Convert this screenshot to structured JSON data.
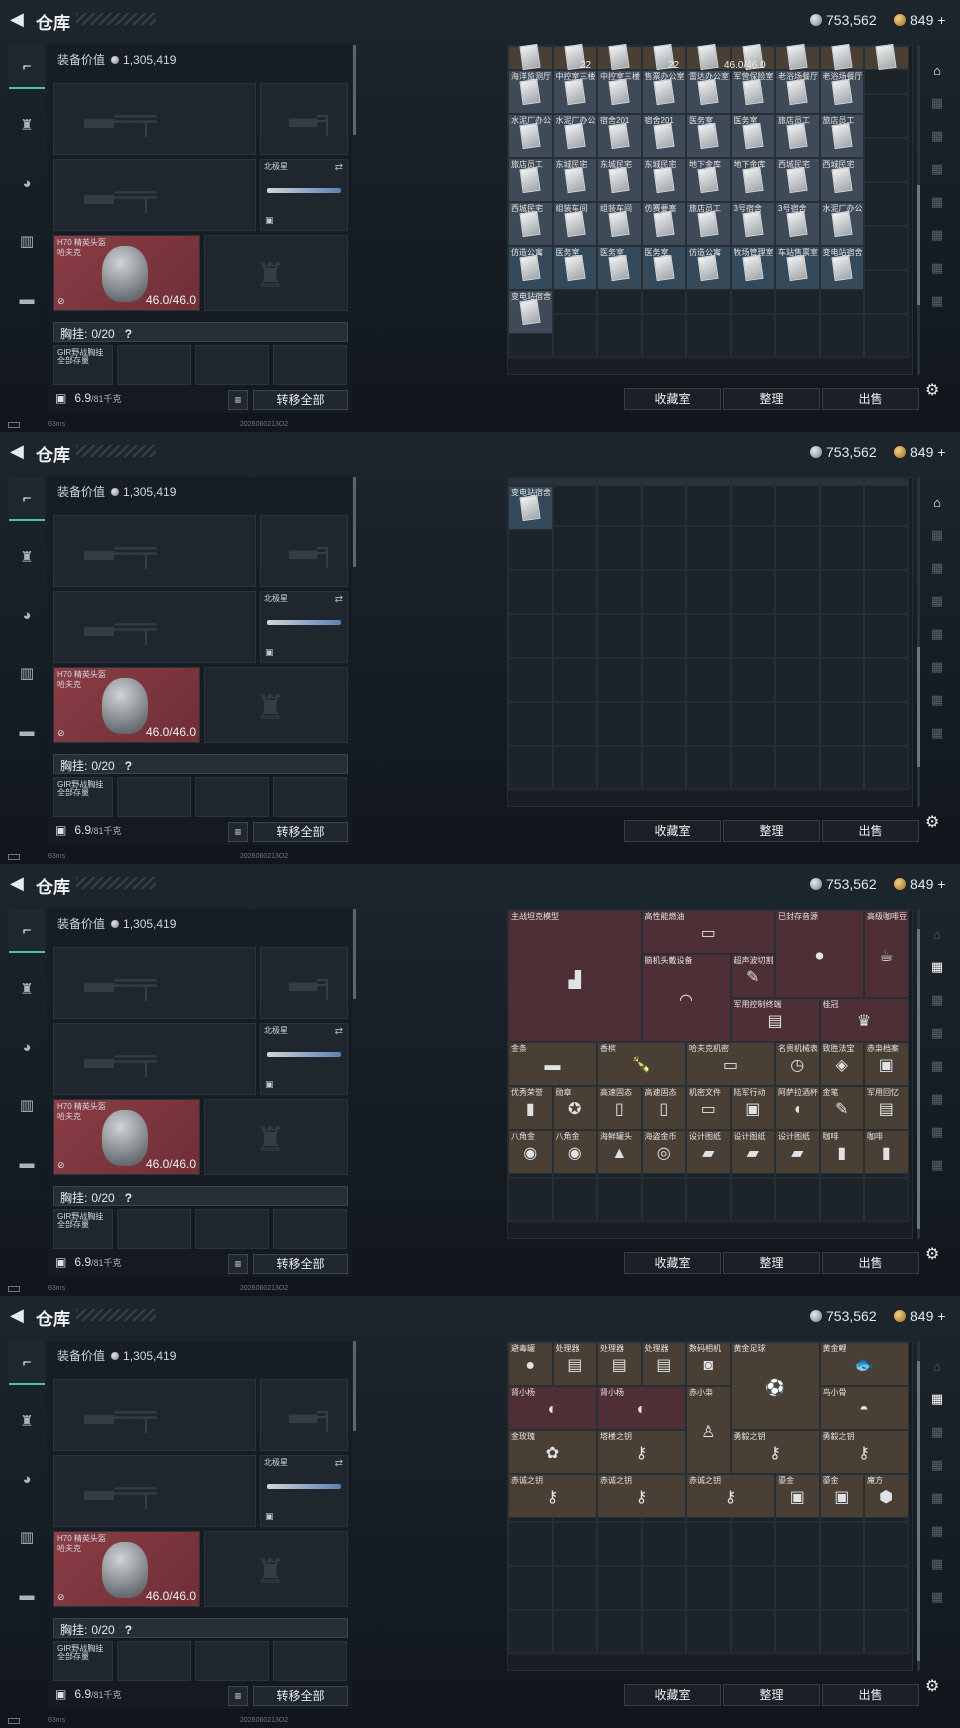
{
  "header": {
    "title": "仓库",
    "silver": "753,562",
    "gold": "849",
    "plus": "+"
  },
  "loadout": {
    "value_label": "装备价值",
    "value": "1,305,419",
    "melee_label": "北极星",
    "helmet_name": "H70 精英头盔",
    "helmet_sub": "哈夫克",
    "durability": "46.0/46.0",
    "chest_label": "胸挂:",
    "chest_value": "0/20",
    "chest_help": "?",
    "bag_label": "GIR野战胸挂",
    "bag_sub": "全部存量",
    "weight": "6.9",
    "weight_unit": "/81千克",
    "transfer_all": "转移全部"
  },
  "actions": {
    "collection": "收藏室",
    "organize": "整理",
    "sell": "出售"
  },
  "status": {
    "ping": "63ms",
    "build": "2026060213O2"
  },
  "panel1": {
    "top_partial": [
      "",
      "",
      "",
      "",
      ""
    ],
    "top_values": [
      "22",
      "22",
      "46.0/46.0"
    ],
    "rows": [
      [
        "海洋监测厅",
        "中控室三楼",
        "中控室三楼",
        "售票办公室",
        "雷达办公室",
        "军营保险室",
        "老浴场餐厅",
        "老浴场餐厅"
      ],
      [
        "水泥厂办公",
        "水泥厂办公",
        "宿舍201",
        "宿舍201",
        "医务室",
        "医务室",
        "旅店员工",
        "旅店员工"
      ],
      [
        "旅店员工",
        "东城民宅",
        "东城民宅",
        "东城民宅",
        "地下金库",
        "地下金库",
        "西城民宅",
        "西城民宅"
      ],
      [
        "西城民宅",
        "组装车间",
        "组装车间",
        "仿赛要塞",
        "旅店员工",
        "3号宿舍",
        "3号宿舍",
        "水泥厂办公"
      ],
      [
        "仿造公寓",
        "医务室",
        "医务室",
        "医务室",
        "仿造公寓",
        "牧场管理室",
        "车站售票室",
        "变电站宿舍"
      ],
      [
        "变电站宿舍"
      ]
    ]
  },
  "panel2": {
    "item": "变电站宿舍"
  },
  "panel3": {
    "items": [
      "主战坦克模型",
      "高性能燃油",
      "已封存音源",
      "高级咖啡豆",
      "脑机头戴设备",
      "超声波切割",
      "军用控制终端",
      "桂冠",
      "金条",
      "香槟",
      "哈夫克机密",
      "名贵机械表",
      "致胜法宝",
      "赤枭档案",
      "优秀荣誉",
      "勋章",
      "高速固态",
      "高速固态",
      "机密文件",
      "陆军行动",
      "阿萨拉酒杯",
      "金笔",
      "军用回忆",
      "八角金",
      "八角金",
      "海鲜罐头",
      "海盗金币",
      "设计图纸",
      "设计图纸",
      "设计图纸",
      "咖啡",
      "咖啡"
    ]
  },
  "panel4": {
    "items": [
      "避毒罐",
      "处理器",
      "处理器",
      "处理器",
      "数码相机",
      "黄金足球",
      "黄金鲤",
      "肾小杨",
      "肾小杨",
      "赤小枭",
      "鸟小骨",
      "金玫瑰",
      "塔楼之钥",
      "勇毅之钥",
      "勇毅之钥",
      "赤诚之钥",
      "赤诚之钥",
      "赤诚之钥",
      "鎏金",
      "鎏金",
      "魔方"
    ]
  }
}
